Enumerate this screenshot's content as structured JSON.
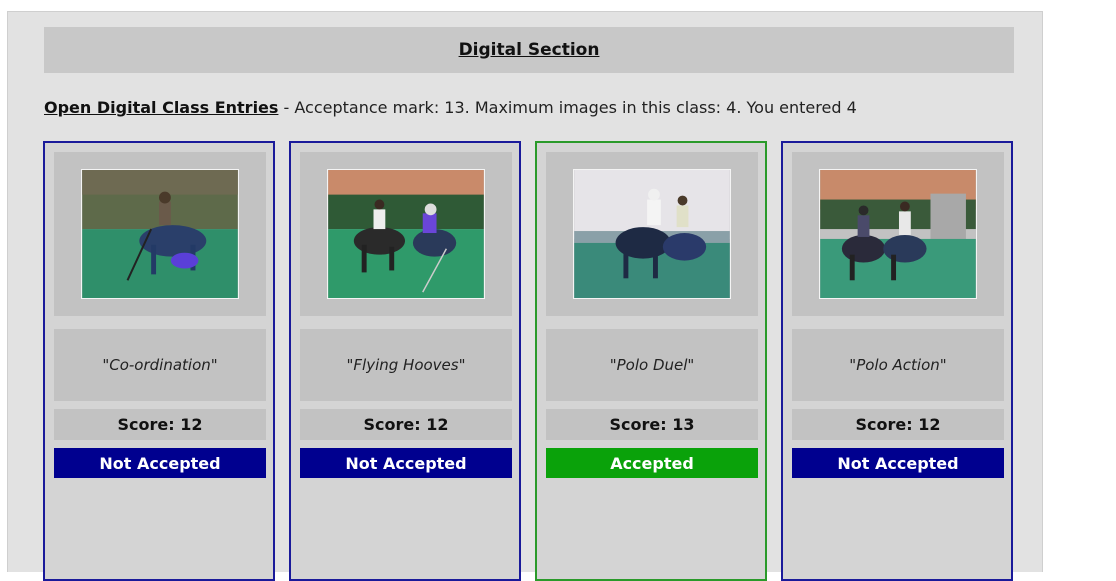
{
  "section": {
    "title": "Digital Section"
  },
  "class_info": {
    "link_label": "Open Digital Class Entries",
    "details": " - Acceptance mark: 13. Maximum images in this class: 4. You entered 4"
  },
  "entries": [
    {
      "title": "\"Co-ordination\"",
      "score": "Score: 12",
      "status": "Not Accepted",
      "photo": "polo-rider-icon"
    },
    {
      "title": "\"Flying Hooves\"",
      "score": "Score: 12",
      "status": "Not Accepted",
      "photo": "polo-horses-icon"
    },
    {
      "title": "\"Polo Duel\"",
      "score": "Score: 13",
      "status": "Accepted",
      "photo": "polo-duel-icon"
    },
    {
      "title": "\"Polo Action\"",
      "score": "Score: 12",
      "status": "Not Accepted",
      "photo": "polo-action-icon"
    }
  ],
  "colors": {
    "not_accepted": "#00008f",
    "accepted": "#0aa20a",
    "card_border": "#1a1a9a",
    "card_border_accepted": "#2a9a2a"
  }
}
